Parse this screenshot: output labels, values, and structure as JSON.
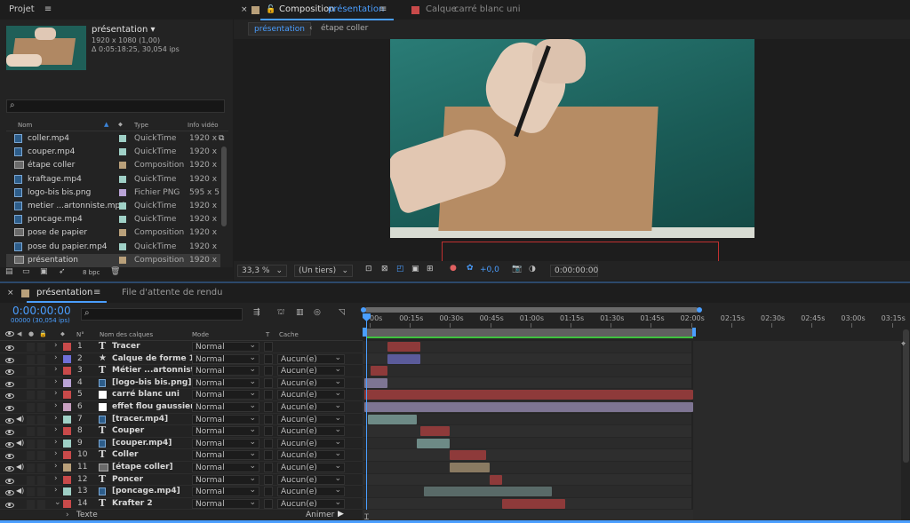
{
  "project": {
    "panel_title": "Projet",
    "comp_name": "présentation",
    "comp_size": "1920 x 1080 (1,00)",
    "comp_duration": "Δ 0:05:18:25, 30,054 ips",
    "search_icon": "search-icon",
    "col_name": "Nom",
    "col_type": "Type",
    "col_video": "Info vidéo",
    "bpc": "8 bpc",
    "items": [
      {
        "name": "coller.mp4",
        "type": "QuickTime",
        "info": "1920 x",
        "kind": "file",
        "color": "#9fd0c6"
      },
      {
        "name": "couper.mp4",
        "type": "QuickTime",
        "info": "1920 x",
        "kind": "file",
        "color": "#9fd0c6"
      },
      {
        "name": "étape coller",
        "type": "Composition",
        "info": "1920 x",
        "kind": "comp",
        "color": "#b9a07a"
      },
      {
        "name": "kraftage.mp4",
        "type": "QuickTime",
        "info": "1920 x",
        "kind": "file",
        "color": "#9fd0c6"
      },
      {
        "name": "logo-bis bis.png",
        "type": "Fichier PNG",
        "info": "595 x 5",
        "kind": "file",
        "color": "#b9a3d6"
      },
      {
        "name": "metier ...artonniste.mp4",
        "type": "QuickTime",
        "info": "1920 x",
        "kind": "file",
        "color": "#9fd0c6"
      },
      {
        "name": "poncage.mp4",
        "type": "QuickTime",
        "info": "1920 x",
        "kind": "file",
        "color": "#9fd0c6"
      },
      {
        "name": "pose de papier",
        "type": "Composition",
        "info": "1920 x",
        "kind": "comp",
        "color": "#b9a07a"
      },
      {
        "name": "pose du papier.mp4",
        "type": "QuickTime",
        "info": "1920 x",
        "kind": "file",
        "color": "#9fd0c6"
      },
      {
        "name": "présentation",
        "type": "Composition",
        "info": "1920 x",
        "kind": "comp",
        "color": "#b9a07a"
      }
    ]
  },
  "viewer": {
    "tab_close": "×",
    "tab_label": "Composition",
    "tab_comp": "présentation",
    "layer_tab_label": "Calque",
    "layer_tab_name": "carré blanc uni",
    "breadcrumb_active": "présentation",
    "breadcrumb_next": "étape coller",
    "zoom": "33,3 %",
    "resolution": "(Un tiers)",
    "exposure": "+0,0",
    "timecode": "0:00:00:00"
  },
  "timeline": {
    "tab_close": "×",
    "tab_label": "présentation",
    "render_queue": "File d'attente de rendu",
    "current_time": "0:00:00:00",
    "frame_info": "00000 (30,054 ips)",
    "col_num": "N°",
    "col_name": "Nom des calques",
    "col_mode": "Mode",
    "col_t": "T",
    "col_cache": "Cache",
    "ruler": [
      "00s",
      "00:15s",
      "00:30s",
      "00:45s",
      "01:00s",
      "01:15s",
      "01:30s",
      "01:45s",
      "02:00s",
      "02:15s",
      "02:30s",
      "02:45s",
      "03:00s",
      "03:15s"
    ],
    "layers": [
      {
        "num": "1",
        "name": "Tracer",
        "mode": "Normal",
        "cache": "",
        "kind": "text",
        "color": "#c84a4a",
        "audio": false,
        "bar": {
          "start": 0.07,
          "end": 0.17,
          "color": "#8e3a3a"
        }
      },
      {
        "num": "2",
        "name": "Calque de forme 1",
        "mode": "Normal",
        "cache": "Aucun(e)",
        "kind": "shape",
        "color": "#7070d8",
        "audio": false,
        "bar": {
          "start": 0.07,
          "end": 0.17,
          "color": "#5b5b9a"
        }
      },
      {
        "num": "3",
        "name": "Métier ...artonniste",
        "mode": "Normal",
        "cache": "Aucun(e)",
        "kind": "text",
        "color": "#c84a4a",
        "audio": false,
        "bar": {
          "start": 0.02,
          "end": 0.07,
          "color": "#8e3a3a"
        }
      },
      {
        "num": "4",
        "name": "[logo-bis bis.png]",
        "mode": "Normal",
        "cache": "Aucun(e)",
        "kind": "file",
        "color": "#b9a3d6",
        "audio": false,
        "bar": {
          "start": 0.0,
          "end": 0.07,
          "color": "#7e7593"
        }
      },
      {
        "num": "5",
        "name": "carré blanc uni",
        "mode": "Normal",
        "cache": "Aucun(e)",
        "kind": "solid",
        "color": "#c84a4a",
        "audio": false,
        "bar": {
          "start": 0.0,
          "end": 1.0,
          "color": "#8e3a3a"
        }
      },
      {
        "num": "6",
        "name": "effet flou gaussien",
        "mode": "Normal",
        "cache": "Aucun(e)",
        "kind": "solid",
        "color": "#c8a0c0",
        "audio": false,
        "bar": {
          "start": 0.0,
          "end": 1.0,
          "color": "#7e7593"
        }
      },
      {
        "num": "7",
        "name": "[tracer.mp4]",
        "mode": "Normal",
        "cache": "Aucun(e)",
        "kind": "file",
        "color": "#9fd0c6",
        "audio": true,
        "bar": {
          "start": 0.01,
          "end": 0.16,
          "color": "#6d8a86"
        }
      },
      {
        "num": "8",
        "name": "Couper",
        "mode": "Normal",
        "cache": "Aucun(e)",
        "kind": "text",
        "color": "#c84a4a",
        "audio": false,
        "bar": {
          "start": 0.17,
          "end": 0.26,
          "color": "#8e3a3a"
        }
      },
      {
        "num": "9",
        "name": "[couper.mp4]",
        "mode": "Normal",
        "cache": "Aucun(e)",
        "kind": "file",
        "color": "#9fd0c6",
        "audio": true,
        "bar": {
          "start": 0.16,
          "end": 0.26,
          "color": "#6d8a86"
        }
      },
      {
        "num": "10",
        "name": "Coller",
        "mode": "Normal",
        "cache": "Aucun(e)",
        "kind": "text",
        "color": "#c84a4a",
        "audio": false,
        "bar": {
          "start": 0.26,
          "end": 0.37,
          "color": "#8e3a3a"
        }
      },
      {
        "num": "11",
        "name": "[étape coller]",
        "mode": "Normal",
        "cache": "Aucun(e)",
        "kind": "comp",
        "color": "#b9a07a",
        "audio": true,
        "bar": {
          "start": 0.26,
          "end": 0.38,
          "color": "#8a7a62"
        }
      },
      {
        "num": "12",
        "name": "Poncer",
        "mode": "Normal",
        "cache": "Aucun(e)",
        "kind": "text",
        "color": "#c84a4a",
        "audio": false,
        "bar": {
          "start": 0.38,
          "end": 0.42,
          "color": "#8e3a3a"
        }
      },
      {
        "num": "13",
        "name": "[poncage.mp4]",
        "mode": "Normal",
        "cache": "Aucun(e)",
        "kind": "file",
        "color": "#9fd0c6",
        "audio": true,
        "bar": {
          "start": 0.18,
          "end": 0.57,
          "color": "#596a68"
        }
      },
      {
        "num": "14",
        "name": "Krafter 2",
        "mode": "Normal",
        "cache": "Aucun(e)",
        "kind": "text",
        "color": "#c84a4a",
        "audio": false,
        "bar": {
          "start": 0.42,
          "end": 0.61,
          "color": "#8e3a3a"
        }
      }
    ],
    "sub_row": "Texte",
    "animate": "Animer :"
  }
}
